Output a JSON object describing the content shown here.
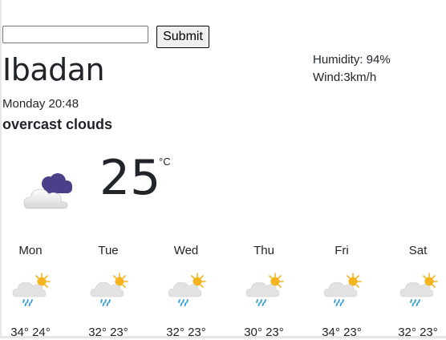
{
  "search": {
    "value": "",
    "placeholder": "",
    "submit_label": "Submit"
  },
  "location": {
    "city": "Ibadan",
    "datetime": "Monday 20:48",
    "description": "overcast clouds"
  },
  "details": {
    "humidity": "Humidity: 94%",
    "wind": "Wind:3km/h"
  },
  "current": {
    "temperature": "25",
    "unit": "°C",
    "icon": "overcast-clouds-icon"
  },
  "forecast": [
    {
      "day": "Mon",
      "temps": "34° 24°",
      "icon": "sun-rain-cloud-icon"
    },
    {
      "day": "Tue",
      "temps": "32° 23°",
      "icon": "sun-rain-cloud-icon"
    },
    {
      "day": "Wed",
      "temps": "32° 23°",
      "icon": "sun-rain-cloud-icon"
    },
    {
      "day": "Thu",
      "temps": "30° 23°",
      "icon": "sun-rain-cloud-icon"
    },
    {
      "day": "Fri",
      "temps": "34° 23°",
      "icon": "sun-rain-cloud-icon"
    },
    {
      "day": "Sat",
      "temps": "32° 23°",
      "icon": "sun-rain-cloud-icon"
    }
  ],
  "colors": {
    "sun": "#f5b41d",
    "cloud": "#dcdcdc",
    "rain": "#2f9bd7",
    "dark_cloud": "#4b3f8a"
  }
}
